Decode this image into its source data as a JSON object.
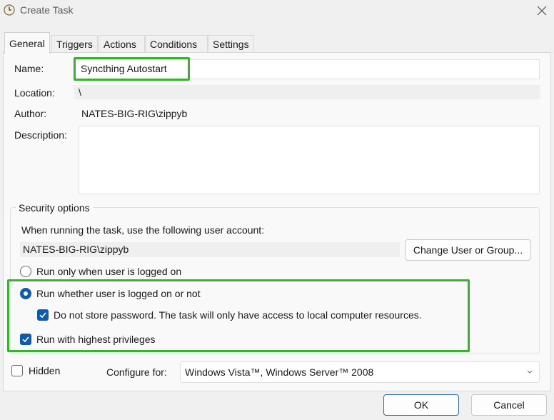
{
  "window": {
    "title": "Create Task",
    "close_icon": "close-icon",
    "app_icon": "task-scheduler-clock-icon"
  },
  "tabs": [
    {
      "label": "General",
      "active": true
    },
    {
      "label": "Triggers"
    },
    {
      "label": "Actions"
    },
    {
      "label": "Conditions"
    },
    {
      "label": "Settings"
    }
  ],
  "general": {
    "name_label": "Name:",
    "name_value": "Syncthing Autostart",
    "location_label": "Location:",
    "location_value": "\\",
    "author_label": "Author:",
    "author_value": "NATES-BIG-RIG\\zippyb",
    "description_label": "Description:",
    "description_value": ""
  },
  "security": {
    "group_title": "Security options",
    "account_prompt": "When running the task, use the following user account:",
    "account_value": "NATES-BIG-RIG\\zippyb",
    "change_button": "Change User or Group...",
    "radio_logged_on": "Run only when user is logged on",
    "radio_whether": "Run whether user is logged on or not",
    "selected_radio": "Run whether user is logged on or not",
    "no_store_password": "Do not store password.  The task will only have access to local computer resources.",
    "no_store_password_checked": true,
    "highest_privileges": "Run with highest privileges",
    "highest_privileges_checked": true
  },
  "footer": {
    "hidden_label": "Hidden",
    "hidden_checked": false,
    "configure_label": "Configure for:",
    "configure_value": "Windows Vista™, Windows Server™ 2008",
    "ok_button": "OK",
    "cancel_button": "Cancel"
  },
  "colors": {
    "accent": "#0b5cad",
    "highlight": "#37b42c"
  }
}
